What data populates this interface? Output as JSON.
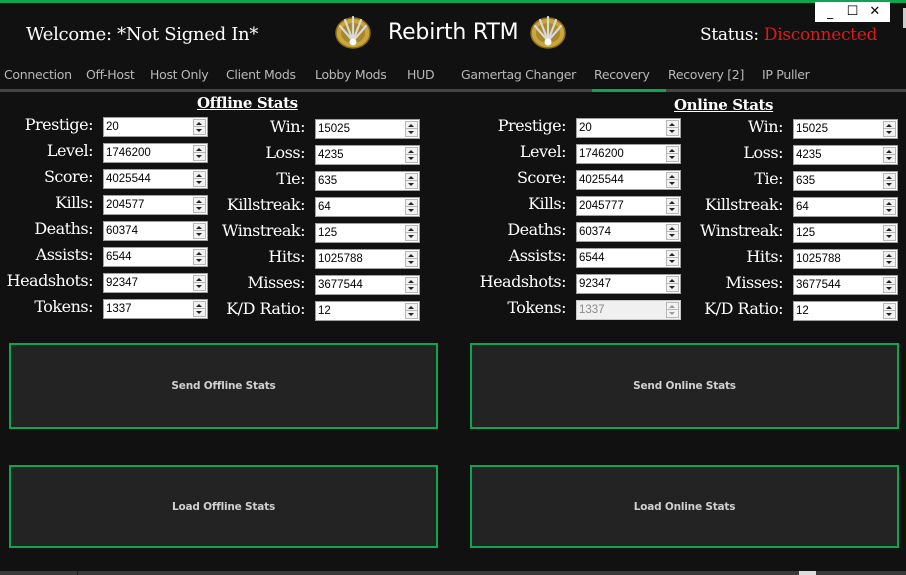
{
  "window": {
    "title": "Rebirth RTM",
    "controls": {
      "minimize": "_",
      "maximize": "☐",
      "close": "✕"
    }
  },
  "header": {
    "welcome_label": "Welcome:",
    "welcome_value": "*Not Signed In*",
    "status_label": "Status:",
    "status_value": "Disconnected",
    "emblem_icon": "gold-emblem-icon"
  },
  "colors": {
    "accent": "#0ea550",
    "status_disconnected": "#e01818",
    "background": "#111111",
    "button_bg": "#232323"
  },
  "tabs": [
    {
      "label": "Connection",
      "active": false
    },
    {
      "label": "Off-Host",
      "active": false
    },
    {
      "label": "Host Only",
      "active": false
    },
    {
      "label": "Client Mods",
      "active": false
    },
    {
      "label": "Lobby Mods",
      "active": false
    },
    {
      "label": "HUD",
      "active": false
    },
    {
      "label": "Gamertag Changer",
      "active": false
    },
    {
      "label": "Recovery",
      "active": true
    },
    {
      "label": "Recovery [2]",
      "active": false
    },
    {
      "label": "IP Puller",
      "active": false
    }
  ],
  "offline": {
    "title": "Offline Stats",
    "left": [
      {
        "label": "Prestige:",
        "value": "20"
      },
      {
        "label": "Level:",
        "value": "1746200"
      },
      {
        "label": "Score:",
        "value": "4025544"
      },
      {
        "label": "Kills:",
        "value": "204577"
      },
      {
        "label": "Deaths:",
        "value": "60374"
      },
      {
        "label": "Assists:",
        "value": "6544"
      },
      {
        "label": "Headshots:",
        "value": "92347"
      },
      {
        "label": "Tokens:",
        "value": "1337"
      }
    ],
    "right": [
      {
        "label": "Win:",
        "value": "15025"
      },
      {
        "label": "Loss:",
        "value": "4235"
      },
      {
        "label": "Tie:",
        "value": "635"
      },
      {
        "label": "Killstreak:",
        "value": "64"
      },
      {
        "label": "Winstreak:",
        "value": "125"
      },
      {
        "label": "Hits:",
        "value": "1025788"
      },
      {
        "label": "Misses:",
        "value": "3677544"
      },
      {
        "label": "K/D Ratio:",
        "value": "12"
      }
    ],
    "send_label": "Send Offline Stats",
    "load_label": "Load Offline Stats"
  },
  "online": {
    "title": "Online Stats",
    "left": [
      {
        "label": "Prestige:",
        "value": "20"
      },
      {
        "label": "Level:",
        "value": "1746200"
      },
      {
        "label": "Score:",
        "value": "4025544"
      },
      {
        "label": "Kills:",
        "value": "2045777"
      },
      {
        "label": "Deaths:",
        "value": "60374"
      },
      {
        "label": "Assists:",
        "value": "6544"
      },
      {
        "label": "Headshots:",
        "value": "92347"
      },
      {
        "label": "Tokens:",
        "value": "1337",
        "disabled": true
      }
    ],
    "right": [
      {
        "label": "Win:",
        "value": "15025"
      },
      {
        "label": "Loss:",
        "value": "4235"
      },
      {
        "label": "Tie:",
        "value": "635"
      },
      {
        "label": "Killstreak:",
        "value": "64"
      },
      {
        "label": "Winstreak:",
        "value": "125"
      },
      {
        "label": "Hits:",
        "value": "1025788"
      },
      {
        "label": "Misses:",
        "value": "3677544"
      },
      {
        "label": "K/D Ratio:",
        "value": "12"
      }
    ],
    "send_label": "Send Online Stats",
    "load_label": "Load Online Stats"
  }
}
